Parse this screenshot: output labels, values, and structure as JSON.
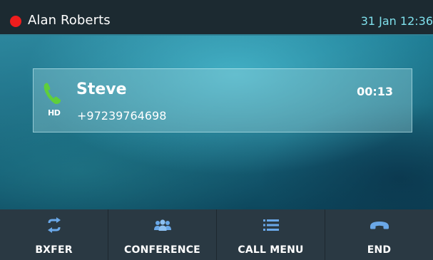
{
  "statusbar": {
    "user_name": "Alan Roberts",
    "datetime": "31 Jan 12:36",
    "presence_color": "#ee1d1d"
  },
  "call": {
    "name": "Steve",
    "number": "+97239764698",
    "duration": "00:13",
    "hd_badge": "HD",
    "phone_icon": "phone-handset-icon",
    "accent_color": "#5fcf3a"
  },
  "softkeys": [
    {
      "label": "BXFER",
      "icon": "transfer-arrows-icon"
    },
    {
      "label": "CONFERENCE",
      "icon": "people-group-icon"
    },
    {
      "label": "CALL MENU",
      "icon": "list-menu-icon"
    },
    {
      "label": "END",
      "icon": "hangup-handset-icon"
    }
  ],
  "colors": {
    "statusbar_bg": "#1c2a31",
    "softkey_bg": "#2a3943",
    "icon_blue": "#6aa8e8",
    "clock_text": "#7fe0ec"
  }
}
